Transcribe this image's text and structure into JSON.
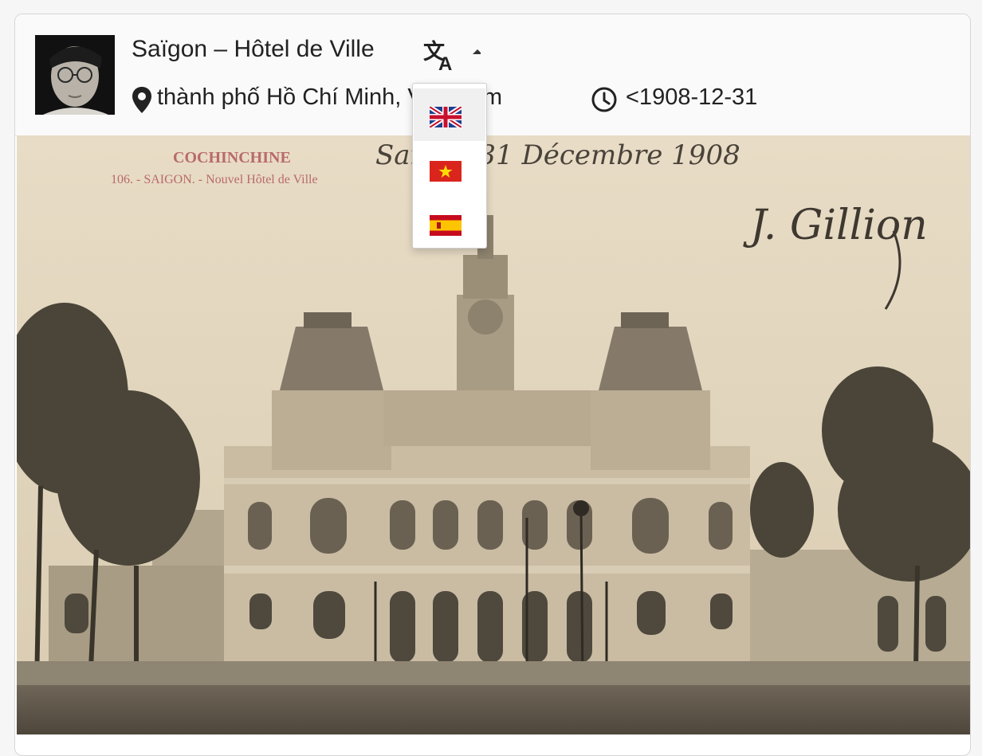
{
  "header": {
    "title": "Saïgon – Hôtel de Ville",
    "location": "thành phố Hồ Chí Minh, Việt Nam",
    "date": "<1908-12-31"
  },
  "icons": {
    "avatar": "avatar-portrait",
    "translate": "translate-icon",
    "location": "map-marker-icon",
    "time": "clock-icon"
  },
  "translate_menu": {
    "items": [
      {
        "flag": "united-kingdom-flag",
        "active": true
      },
      {
        "flag": "vietnam-flag",
        "active": false
      },
      {
        "flag": "spain-flag",
        "active": false
      }
    ]
  },
  "photo": {
    "caption_line1": "COCHINCHINE",
    "caption_line2": "106. - SAIGON. - Nouvel Hôtel de Ville",
    "handwritten": "Saigon 31 Décembre 1908",
    "signature": "J. Gillion"
  }
}
